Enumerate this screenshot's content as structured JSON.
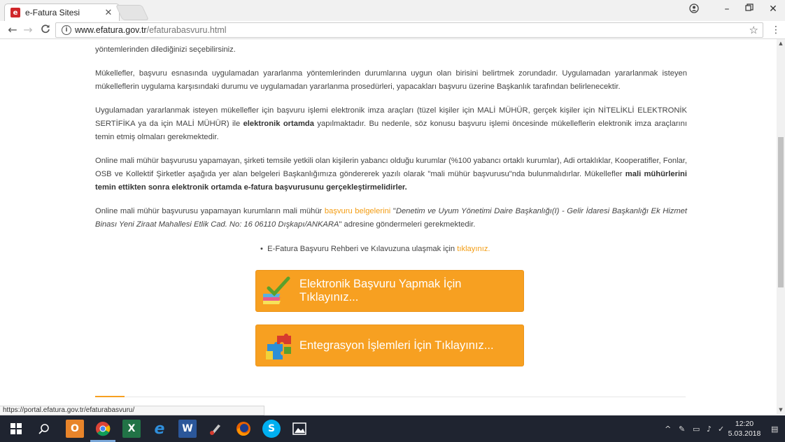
{
  "browser": {
    "tab_title": "e-Fatura Sitesi",
    "tab_favicon": "e",
    "url_host": "www.efatura.gov.tr",
    "url_path": "/efaturabasvuru.html"
  },
  "content": {
    "p0": "yöntemlerinden dilediğinizi seçebilirsiniz.",
    "p1": "Mükellefler, başvuru esnasında uygulamadan yararlanma yöntemlerinden durumlarına uygun olan birisini belirtmek zorundadır. Uygulamadan yararlanmak isteyen mükelleflerin uygulama karşısındaki durumu ve uygulamadan yararlanma prosedürleri, yapacakları başvuru üzerine Başkanlık tarafından belirlenecektir.",
    "p2_a": "Uygulamadan yararlanmak isteyen mükellefler için başvuru işlemi elektronik imza araçları (tüzel kişiler için MALİ MÜHÜR, gerçek kişiler için NİTELİKLİ ELEKTRONİK SERTİFİKA ya da için MALİ MÜHÜR) ile ",
    "p2_b": "elektronik ortamda",
    "p2_c": " yapılmaktadır. Bu nedenle, söz konusu başvuru işlemi öncesinde mükelleflerin elektronik imza araçlarını temin etmiş olmaları gerekmektedir.",
    "p3_a": "Online mali mühür başvurusu yapamayan, şirketi temsile yetkili olan kişilerin yabancı olduğu kurumlar (%100 yabancı ortaklı kurumlar), Adi ortaklıklar, Kooperatifler, Fonlar, OSB ve Kollektif Şirketler aşağıda yer alan belgeleri Başkanlığımıza göndererek yazılı olarak \"mali mühür başvurusu\"nda bulunmalıdırlar. Mükellefler ",
    "p3_b": "mali mühürlerini temin ettikten sonra elektronik ortamda e-fatura başvurusunu gerçekleştirmelidirler.",
    "p4_a": "Online mali mühür başvurusu yapamayan kurumların mali mühür ",
    "p4_link": "başvuru belgelerini",
    "p4_b": " \"",
    "p4_italic": "Denetim ve Uyum Yönetimi Daire Başkanlığı(I) - Gelir İdaresi Başkanlığı Ek Hizmet Binası Yeni Ziraat Mahallesi Etlik Cad. No: 16 06110 Dışkapı/ANKARA",
    "p4_c": "\" adresine göndermeleri gerekmektedir."
  },
  "guide": {
    "bullet": "•",
    "text": "E-Fatura Başvuru Rehberi ve Kılavuzuna ulaşmak için ",
    "link": "tıklayınız."
  },
  "buttons": {
    "apply": "Elektronik Başvuru Yapmak İçin Tıklayınız...",
    "integration": "Entegrasyon İşlemleri İçin Tıklayınız..."
  },
  "status_url": "https://portal.efatura.gov.tr/efaturabasvuru/",
  "clock": {
    "time": "12:20",
    "date": "5.03.2018"
  },
  "colors": {
    "accent": "#f7a021",
    "link": "#f39c12",
    "taskbar": "#1f2430"
  }
}
